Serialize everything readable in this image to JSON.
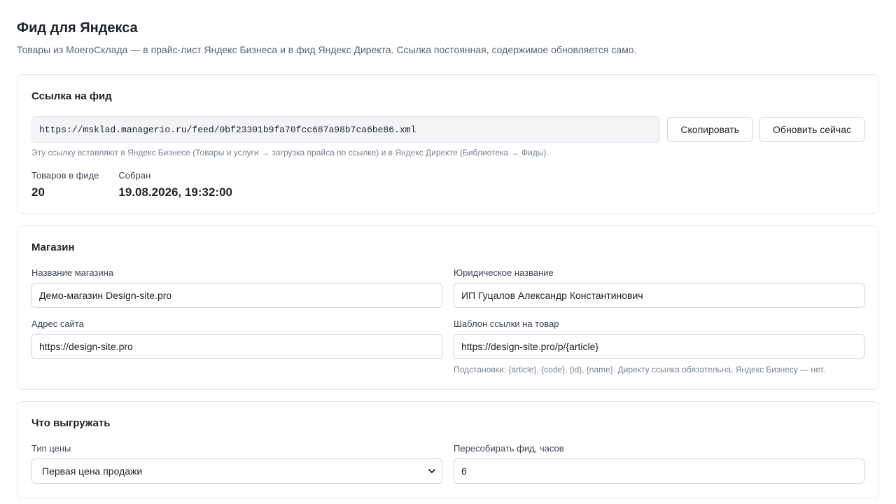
{
  "page": {
    "title": "Фид для Яндекса",
    "subtitle": "Товары из МоегоСклада — в прайс-лист Яндекс Бизнеса и в фид Яндекс Директа. Ссылка постоянная, содержимое обновляется само."
  },
  "feed_card": {
    "title": "Ссылка на фид",
    "url": "https://msklad.managerio.ru/feed/0bf23301b9fa70fcc687a98b7ca6be86.xml",
    "copy_label": "Скопировать",
    "refresh_label": "Обновить сейчас",
    "hint": "Эту ссылку вставляют в Яндекс Бизнесе (Товары и услуги → загрузка прайса по ссылке) и в Яндекс Директе (Библиотека → Фиды).",
    "stats": {
      "items_label": "Товаров в фиде",
      "items_value": "20",
      "built_label": "Собран",
      "built_value": "19.08.2026, 19:32:00"
    }
  },
  "shop_card": {
    "title": "Магазин",
    "shop_name_label": "Название магазина",
    "shop_name_value": "Демо-магазин Design-site.pro",
    "legal_name_label": "Юридическое название",
    "legal_name_value": "ИП Гуцалов Александр Константинович",
    "site_url_label": "Адрес сайта",
    "site_url_value": "https://design-site.pro",
    "link_template_label": "Шаблон ссылки на товар",
    "link_template_value": "https://design-site.pro/p/{article}",
    "link_template_hint": "Подстановки: {article}, {code}, {id}, {name}. Директу ссылка обязательна, Яндекс Бизнесу — нет."
  },
  "export_card": {
    "title": "Что выгружать",
    "price_type_label": "Тип цены",
    "price_type_value": "Первая цена продажи",
    "rebuild_label": "Пересобирать фид, часов",
    "rebuild_value": "6"
  },
  "icons": {
    "select_arrow": "chevron-down-icon"
  },
  "colors": {
    "text": "#1f2328",
    "muted": "#7a8390",
    "border": "#cfd4da",
    "card_border": "#e3e6ea",
    "url_bg": "#f3f4f6"
  }
}
